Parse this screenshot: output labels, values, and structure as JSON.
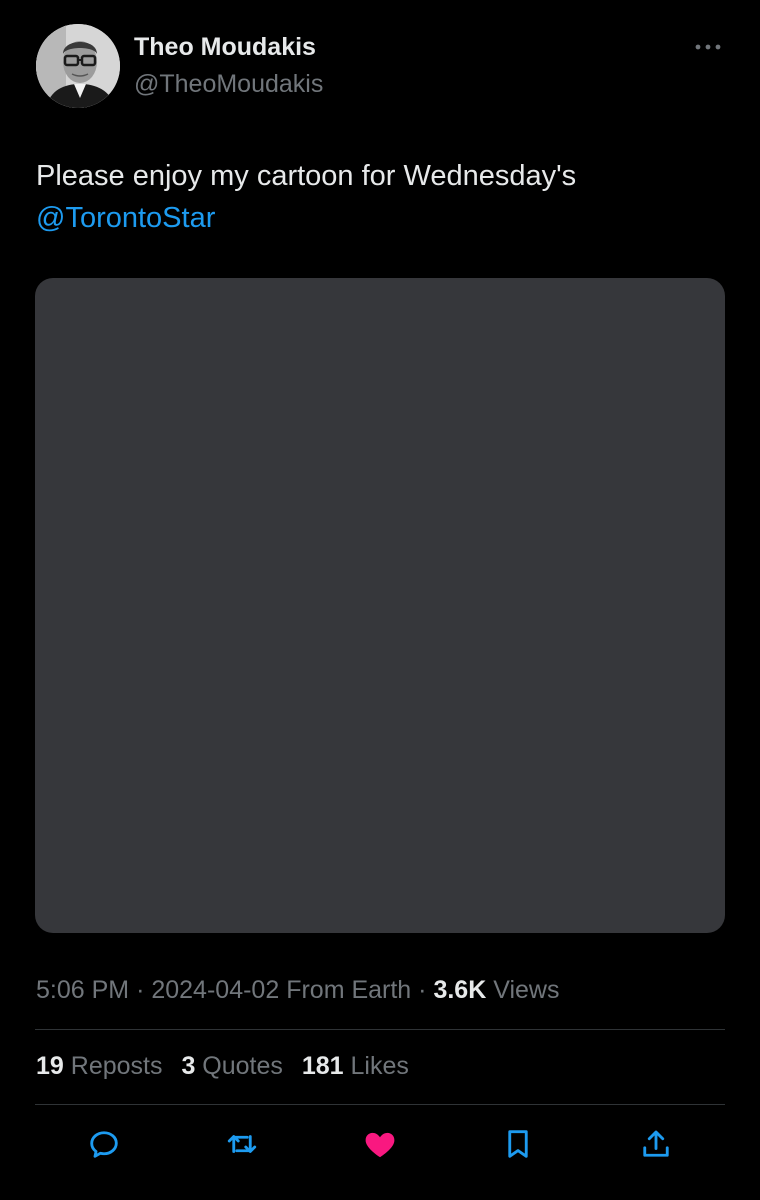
{
  "author": {
    "display_name": "Theo Moudakis",
    "handle": "@TheoMoudakis"
  },
  "tweet": {
    "text": "Please enjoy my cartoon for Wednesday's",
    "mention": "@TorontoStar"
  },
  "meta": {
    "time": "5:06 PM",
    "separator_1": "·",
    "date": "2024-04-02",
    "location": "From Earth",
    "separator_2": "·",
    "views_count": "3.6K",
    "views_label": "Views"
  },
  "stats": {
    "reposts_count": "19",
    "reposts_label": "Reposts",
    "quotes_count": "3",
    "quotes_label": "Quotes",
    "likes_count": "181",
    "likes_label": "Likes"
  },
  "actions": {
    "reply_icon": "reply-icon",
    "repost_icon": "repost-icon",
    "like_icon": "heart-icon",
    "bookmark_icon": "bookmark-icon",
    "share_icon": "share-icon",
    "liked": true
  },
  "colors": {
    "background": "#000000",
    "text_primary": "#e7e9ea",
    "text_secondary": "#71767b",
    "link": "#1d9bf0",
    "like_active": "#f91880",
    "media_placeholder": "#36373b",
    "divider": "#2f3336"
  }
}
